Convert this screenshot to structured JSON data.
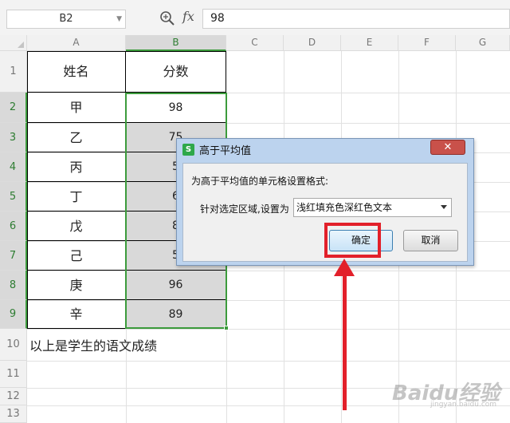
{
  "formula_bar": {
    "name_box": "B2",
    "fx_label": "fx",
    "formula_value": "98"
  },
  "columns": [
    "A",
    "B",
    "C",
    "D",
    "E",
    "F",
    "G"
  ],
  "rows": [
    "1",
    "2",
    "3",
    "4",
    "5",
    "6",
    "7",
    "8",
    "9",
    "10",
    "11",
    "12",
    "13"
  ],
  "table": {
    "header_name": "姓名",
    "header_score": "分数",
    "names": [
      "甲",
      "乙",
      "丙",
      "丁",
      "戊",
      "己",
      "庚",
      "辛"
    ],
    "scores": [
      "98",
      "75",
      "5",
      "6",
      "8",
      "5",
      "96",
      "89"
    ]
  },
  "note": "以上是学生的语文成绩",
  "dialog": {
    "title": "高于平均值",
    "logo_letter": "S",
    "close_glyph": "✕",
    "description": "为高于平均值的单元格设置格式:",
    "range_label": "针对选定区域,设置为",
    "format_value": "浅红填充色深红色文本",
    "ok_label": "确定",
    "cancel_label": "取消"
  },
  "watermark": {
    "text": "Baidu经验",
    "sub": "jingyan.baidu.com"
  },
  "colors": {
    "selection": "#3c9b3c",
    "highlight": "#e2202a"
  }
}
